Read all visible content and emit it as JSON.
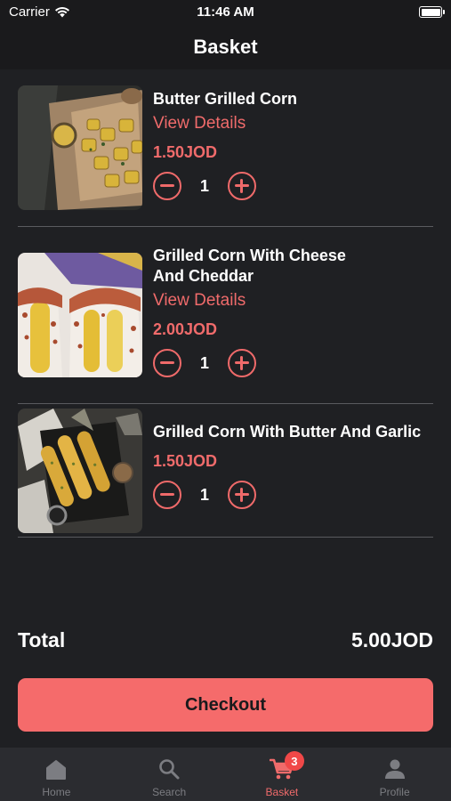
{
  "status_bar": {
    "carrier": "Carrier",
    "time": "11:46 AM"
  },
  "header": {
    "title": "Basket"
  },
  "items": [
    {
      "name": "Butter Grilled Corn",
      "details_link": "View Details",
      "price": "1.50JOD",
      "quantity": "1"
    },
    {
      "name": "Grilled Corn With Cheese And Cheddar",
      "details_link": "View Details",
      "price": "2.00JOD",
      "quantity": "1"
    },
    {
      "name": "Grilled Corn With Butter And Garlic",
      "price": "1.50JOD",
      "quantity": "1"
    }
  ],
  "summary": {
    "total_label": "Total",
    "total_value": "5.00JOD"
  },
  "checkout": {
    "label": "Checkout"
  },
  "tabs": [
    {
      "label": "Home",
      "icon": "home-icon"
    },
    {
      "label": "Search",
      "icon": "search-icon"
    },
    {
      "label": "Basket",
      "icon": "cart-icon",
      "badge": "3"
    },
    {
      "label": "Profile",
      "icon": "person-icon"
    }
  ],
  "colors": {
    "accent": "#f56b6b",
    "background": "#1f2023",
    "tab_bar": "#2b2c30",
    "badge": "#f04848"
  }
}
